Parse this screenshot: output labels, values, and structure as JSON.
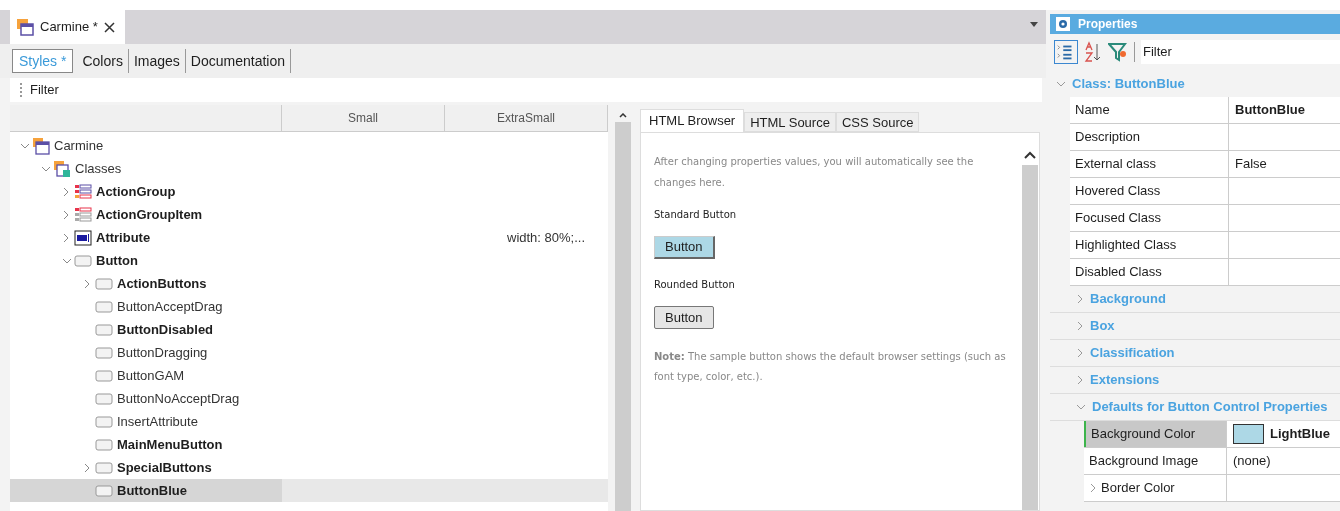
{
  "document_tabs": [
    {
      "label": "Carmine *",
      "selected": true
    }
  ],
  "subtabs": [
    {
      "label": "Styles *",
      "selected": true
    },
    {
      "label": "Colors",
      "selected": false
    },
    {
      "label": "Images",
      "selected": false
    },
    {
      "label": "Documentation",
      "selected": false
    }
  ],
  "filter_label": "Filter",
  "tree": {
    "columns": [
      "Small",
      "ExtraSmall"
    ],
    "items": [
      {
        "label": "Carmine",
        "kind": "folder",
        "bold": false,
        "selected": false,
        "expanded": true,
        "children": [
          {
            "label": "Classes",
            "kind": "classes",
            "bold": false,
            "selected": false,
            "expanded": true,
            "children": [
              {
                "label": "ActionGroup",
                "kind": "action-group",
                "bold": true,
                "selected": false,
                "expanded": false
              },
              {
                "label": "ActionGroupItem",
                "kind": "action-group-item",
                "bold": true,
                "selected": false,
                "expanded": false
              },
              {
                "label": "Attribute",
                "kind": "attribute",
                "bold": true,
                "selected": false,
                "expanded": false,
                "extra_small": "width: 80%;..."
              },
              {
                "label": "Button",
                "kind": "button",
                "bold": true,
                "selected": false,
                "expanded": true,
                "children": [
                  {
                    "label": "ActionButtons",
                    "kind": "button",
                    "bold": true,
                    "selected": false,
                    "expanded": false
                  },
                  {
                    "label": "ButtonAcceptDrag",
                    "kind": "button",
                    "bold": false,
                    "selected": false
                  },
                  {
                    "label": "ButtonDisabled",
                    "kind": "button",
                    "bold": true,
                    "selected": false
                  },
                  {
                    "label": "ButtonDragging",
                    "kind": "button",
                    "bold": false,
                    "selected": false
                  },
                  {
                    "label": "ButtonGAM",
                    "kind": "button",
                    "bold": false,
                    "selected": false
                  },
                  {
                    "label": "ButtonNoAcceptDrag",
                    "kind": "button",
                    "bold": false,
                    "selected": false
                  },
                  {
                    "label": "InsertAttribute",
                    "kind": "button",
                    "bold": false,
                    "selected": false
                  },
                  {
                    "label": "MainMenuButton",
                    "kind": "button",
                    "bold": true,
                    "selected": false
                  },
                  {
                    "label": "SpecialButtons",
                    "kind": "button",
                    "bold": true,
                    "selected": false,
                    "expanded": false
                  },
                  {
                    "label": "ButtonBlue",
                    "kind": "button",
                    "bold": true,
                    "selected": true
                  }
                ]
              }
            ]
          }
        ]
      }
    ]
  },
  "preview": {
    "tabs": [
      {
        "label": "HTML Browser",
        "selected": true
      },
      {
        "label": "HTML Source",
        "selected": false
      },
      {
        "label": "CSS Source",
        "selected": false
      }
    ],
    "intro": "After changing properties values, you will automatically see the changes here.",
    "samples": [
      {
        "label": "Standard Button",
        "button": "Button",
        "kind": "standard"
      },
      {
        "label": "Rounded Button",
        "button": "Button",
        "kind": "rounded"
      }
    ],
    "note": "**Note:** The sample button shows the default browser settings (such as font type, color, etc.)."
  },
  "properties": {
    "title": "Properties",
    "filter_label": "Filter",
    "sections": [
      {
        "label": "Class: ButtonBlue",
        "expanded": true,
        "rows": [
          {
            "name": "Name",
            "value": "ButtonBlue",
            "bold": true,
            "selected": false
          },
          {
            "name": "Description",
            "selected": false
          },
          {
            "name": "External class",
            "value": "False",
            "bold": false,
            "selected": false
          },
          {
            "name": "Hovered Class",
            "selected": false
          },
          {
            "name": "Focused Class",
            "selected": false
          },
          {
            "name": "Highlighted Class",
            "selected": false
          },
          {
            "name": "Disabled Class",
            "selected": false
          }
        ]
      },
      {
        "label": "Background",
        "expanded": false
      },
      {
        "label": "Box",
        "expanded": false
      },
      {
        "label": "Classification",
        "expanded": false
      },
      {
        "label": "Extensions",
        "expanded": false
      },
      {
        "label": "Defaults for Button Control Properties",
        "expanded": true,
        "rows": [
          {
            "name": "Background Color",
            "value": "LightBlue",
            "bold": true,
            "selected": true,
            "kind": "color",
            "color": "#add8e6"
          },
          {
            "name": "Background Image",
            "value": "(none)",
            "bold": false,
            "selected": false
          },
          {
            "name": "Border Color",
            "selected": false,
            "expanded": false
          }
        ]
      }
    ]
  }
}
